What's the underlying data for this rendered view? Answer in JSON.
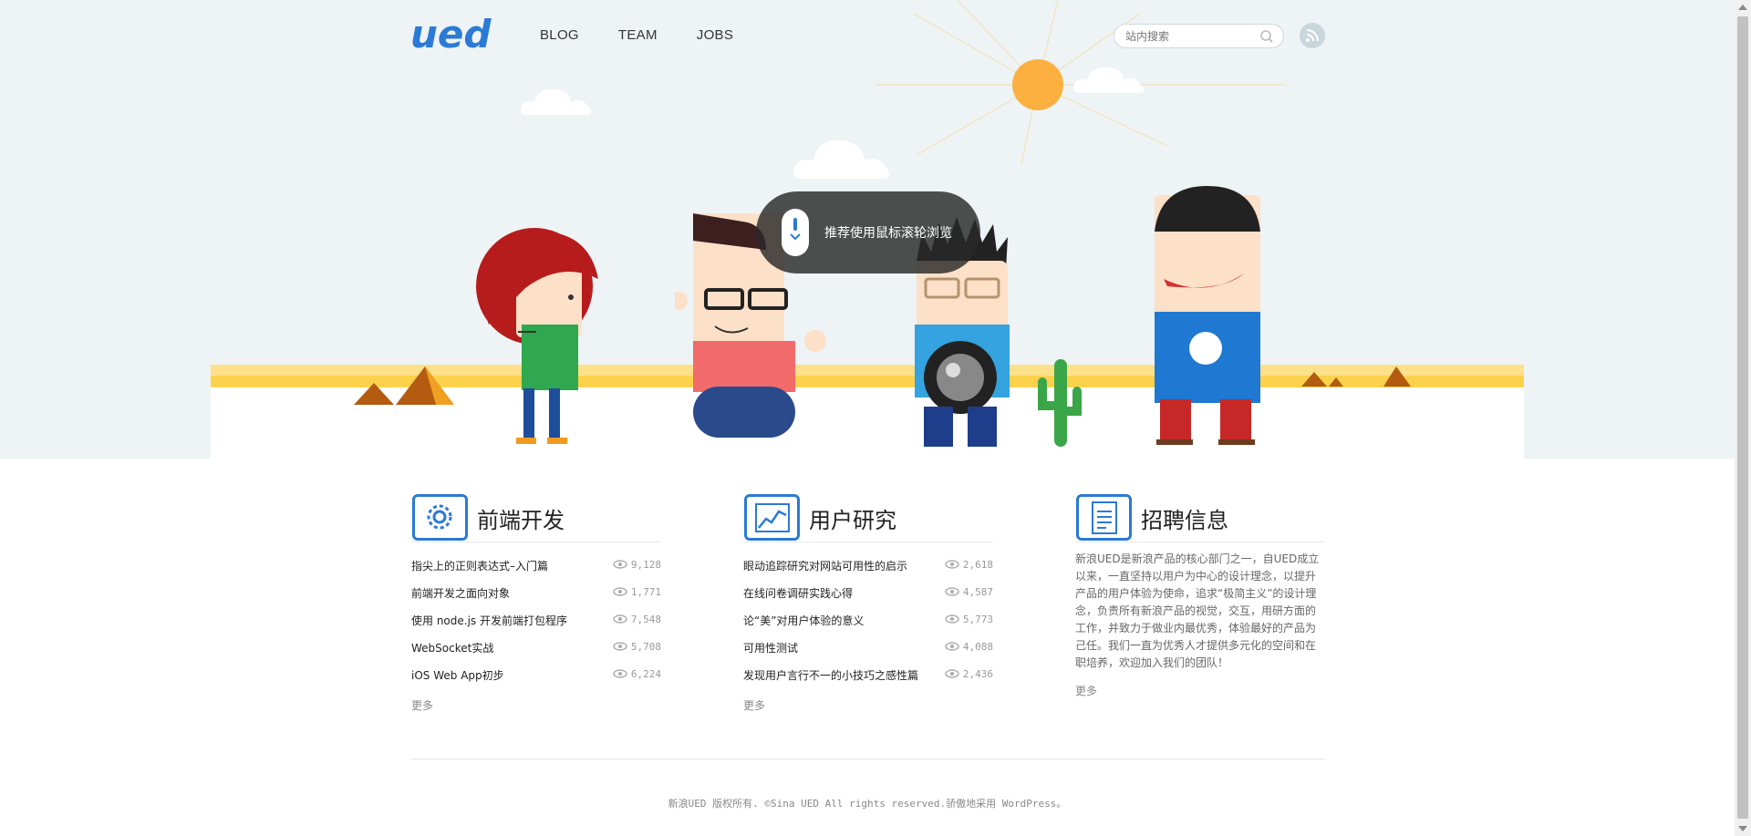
{
  "header": {
    "logo_text": "ued",
    "nav": [
      "BLOG",
      "TEAM",
      "JOBS"
    ],
    "search_placeholder": "站内搜索"
  },
  "hero": {
    "tip_text": "推荐使用鼠标滚轮浏览"
  },
  "sections": [
    {
      "title": "前端开发",
      "icon": "gear-icon",
      "items": [
        {
          "title": "指尖上的正则表达式–入门篇",
          "views": "9,128"
        },
        {
          "title": "前端开发之面向对象",
          "views": "1,771"
        },
        {
          "title": "使用 node.js 开发前端打包程序",
          "views": "7,548"
        },
        {
          "title": "WebSocket实战",
          "views": "5,708"
        },
        {
          "title": "iOS Web App初步",
          "views": "6,224"
        }
      ],
      "more": "更多"
    },
    {
      "title": "用户研究",
      "icon": "chart-icon",
      "items": [
        {
          "title": "眼动追踪研究对网站可用性的启示",
          "views": "2,618"
        },
        {
          "title": "在线问卷调研实践心得",
          "views": "4,587"
        },
        {
          "title": "论“美”对用户体验的意义",
          "views": "5,773"
        },
        {
          "title": "可用性测试",
          "views": "4,088"
        },
        {
          "title": "发现用户言行不一的小技巧之感性篇",
          "views": "2,436"
        }
      ],
      "more": "更多"
    },
    {
      "title": "招聘信息",
      "icon": "notepad-icon",
      "text": "新浪UED是新浪产品的核心部门之一，自UED成立以来，一直坚持以用户为中心的设计理念，以提升产品的用户体验为使命，追求“极简主义”的设计理念，负责所有新浪产品的视觉，交互，用研方面的工作，并致力于做业内最优秀，体验最好的产品为己任。我们一直为优秀人才提供多元化的空间和在职培养，欢迎加入我们的团队！",
      "more": "更多"
    }
  ],
  "footer": {
    "text": "新浪UED 版权所有. ©Sina UED All rights reserved.骄傲地采用 WordPress。"
  },
  "colors": {
    "accent": "#2b7ad5",
    "sky": "#eef3f5",
    "sun": "#fbb040",
    "sand": "#fcd24c"
  }
}
